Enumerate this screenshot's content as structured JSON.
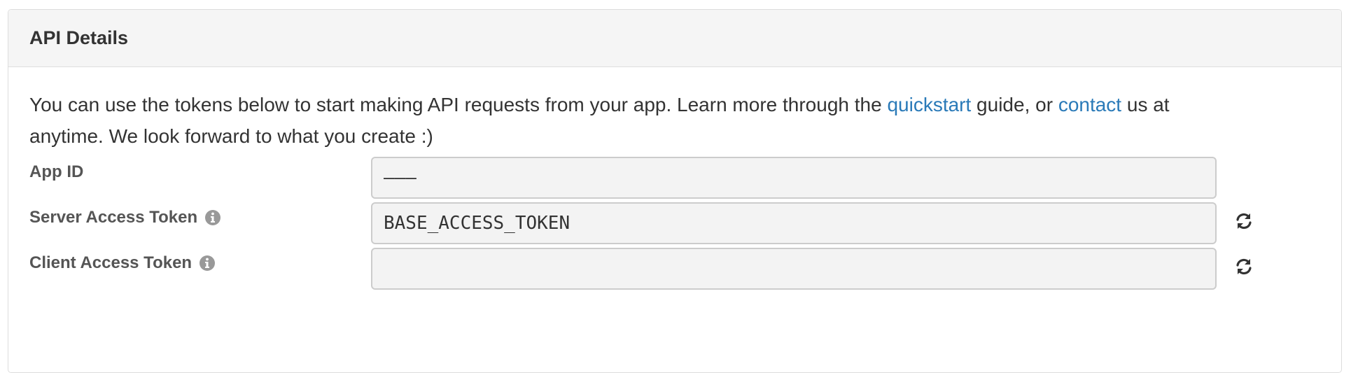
{
  "panel": {
    "title": "API Details"
  },
  "intro": {
    "text_before": "You can use the tokens below to start making API requests from your app. Learn more through the ",
    "quickstart_link": "quickstart",
    "text_middle": " guide, or ",
    "contact_link": "contact",
    "text_after": " us at anytime. We look forward to what you create :)"
  },
  "fields": {
    "app_id": {
      "label": "App ID",
      "value": "———"
    },
    "server_token": {
      "label": "Server Access Token",
      "value": "BASE_ACCESS_TOKEN",
      "info_icon": "info-circle-icon",
      "refresh_icon": "refresh-icon"
    },
    "client_token": {
      "label": "Client Access Token",
      "value": "",
      "info_icon": "info-circle-icon",
      "refresh_icon": "refresh-icon"
    }
  },
  "colors": {
    "link": "#2a7ab8",
    "heading_bg": "#f5f5f5",
    "input_bg": "#f3f3f3",
    "border": "#dddddd"
  }
}
